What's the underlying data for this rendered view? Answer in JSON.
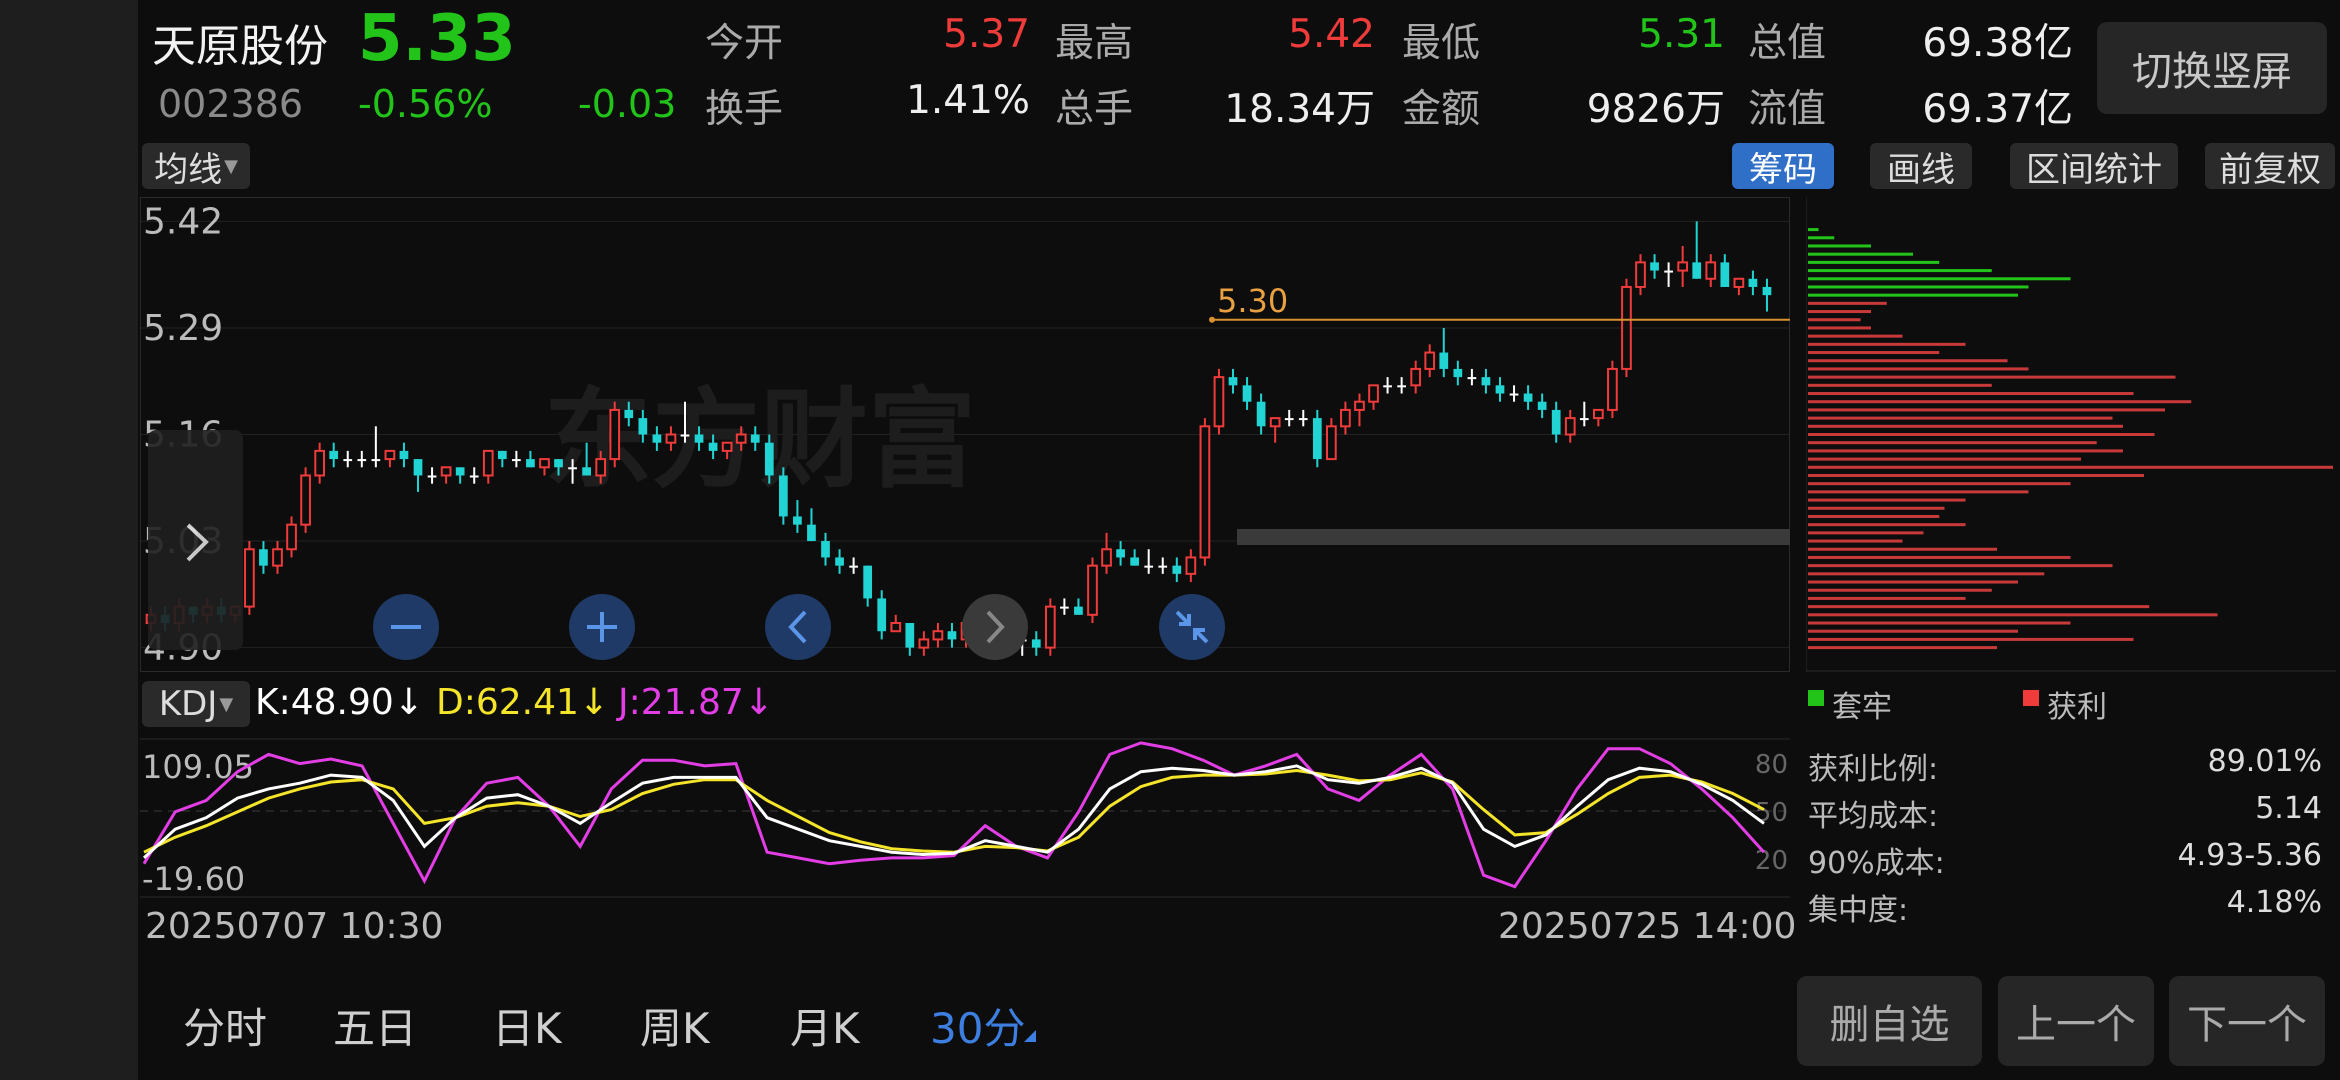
{
  "stock": {
    "name": "天原股份",
    "code": "002386",
    "price": "5.33",
    "change_pct": "-0.56%",
    "change": "-0.03"
  },
  "quote": {
    "open_label": "今开",
    "open": "5.37",
    "high_label": "最高",
    "high": "5.42",
    "low_label": "最低",
    "low": "5.31",
    "mcap_label": "总值",
    "mcap": "69.38亿",
    "turnover_label": "换手",
    "turnover": "1.41%",
    "volume_label": "总手",
    "volume": "18.34万",
    "amount_label": "金额",
    "amount": "9826万",
    "float_label": "流值",
    "float": "69.37亿"
  },
  "buttons": {
    "portrait": "切换竖屏",
    "ma": "均线",
    "chips": "筹码",
    "draw": "画线",
    "range_stats": "区间统计",
    "adjust": "前复权",
    "delete_fav": "删自选",
    "prev": "上一个",
    "next": "下一个"
  },
  "colors": {
    "up": "#f03b3b",
    "down": "#22d3d3",
    "k": "#ffffff",
    "d": "#f5e52a",
    "j": "#e33ee6",
    "accent": "#2f6fc8"
  },
  "price_axis": [
    "5.42",
    "5.29",
    "5.16",
    "5.03",
    "4.90"
  ],
  "marker_price": "5.30",
  "watermark": "东方财富",
  "kdj": {
    "selector": "KDJ",
    "k": "K:48.90↓",
    "d": "D:62.41↓",
    "j": "J:21.87↓",
    "axis_top": "109.05",
    "axis_bottom": "-19.60",
    "ref_levels": [
      "80",
      "50",
      "20"
    ]
  },
  "dates": {
    "start": "20250707 10:30",
    "end": "20250725 14:00"
  },
  "periods": [
    "分时",
    "五日",
    "日K",
    "周K",
    "月K",
    "30分"
  ],
  "active_period": "30分",
  "chips": {
    "legend_trapped": "套牢",
    "legend_profit": "获利",
    "profit_ratio_label": "获利比例:",
    "profit_ratio": "89.01%",
    "avg_cost_label": "平均成本:",
    "avg_cost": "5.14",
    "cost90_label": "90%成本:",
    "cost90": "4.93-5.36",
    "concentration_label": "集中度:",
    "concentration": "4.18%"
  },
  "chart_data": {
    "type": "candlestick",
    "ylim": [
      4.88,
      5.44
    ],
    "candles": [
      [
        4.93,
        4.95,
        4.92,
        4.94
      ],
      [
        4.94,
        4.95,
        4.92,
        4.93
      ],
      [
        4.93,
        4.96,
        4.92,
        4.95
      ],
      [
        4.95,
        4.95,
        4.93,
        4.94
      ],
      [
        4.94,
        4.96,
        4.93,
        4.95
      ],
      [
        4.95,
        4.96,
        4.93,
        4.94
      ],
      [
        4.94,
        4.95,
        4.93,
        4.95
      ],
      [
        4.95,
        5.03,
        4.94,
        5.02
      ],
      [
        5.02,
        5.03,
        4.99,
        5.0
      ],
      [
        5.0,
        5.03,
        4.99,
        5.02
      ],
      [
        5.02,
        5.06,
        5.01,
        5.05
      ],
      [
        5.05,
        5.12,
        5.04,
        5.11
      ],
      [
        5.11,
        5.15,
        5.1,
        5.14
      ],
      [
        5.14,
        5.15,
        5.12,
        5.13
      ],
      [
        5.13,
        5.14,
        5.12,
        5.13
      ],
      [
        5.13,
        5.14,
        5.12,
        5.13
      ],
      [
        5.13,
        5.17,
        5.12,
        5.13
      ],
      [
        5.13,
        5.14,
        5.12,
        5.14
      ],
      [
        5.14,
        5.15,
        5.12,
        5.13
      ],
      [
        5.13,
        5.13,
        5.09,
        5.11
      ],
      [
        5.11,
        5.12,
        5.1,
        5.11
      ],
      [
        5.11,
        5.12,
        5.1,
        5.12
      ],
      [
        5.12,
        5.12,
        5.1,
        5.11
      ],
      [
        5.11,
        5.12,
        5.1,
        5.11
      ],
      [
        5.11,
        5.14,
        5.1,
        5.14
      ],
      [
        5.14,
        5.14,
        5.12,
        5.13
      ],
      [
        5.13,
        5.14,
        5.12,
        5.13
      ],
      [
        5.13,
        5.14,
        5.12,
        5.12
      ],
      [
        5.12,
        5.13,
        5.11,
        5.13
      ],
      [
        5.13,
        5.13,
        5.11,
        5.12
      ],
      [
        5.12,
        5.13,
        5.1,
        5.12
      ],
      [
        5.12,
        5.15,
        5.11,
        5.11
      ],
      [
        5.11,
        5.14,
        5.1,
        5.13
      ],
      [
        5.13,
        5.2,
        5.12,
        5.19
      ],
      [
        5.19,
        5.2,
        5.17,
        5.18
      ],
      [
        5.18,
        5.19,
        5.15,
        5.16
      ],
      [
        5.16,
        5.17,
        5.14,
        5.15
      ],
      [
        5.15,
        5.17,
        5.14,
        5.16
      ],
      [
        5.16,
        5.2,
        5.15,
        5.16
      ],
      [
        5.16,
        5.17,
        5.14,
        5.15
      ],
      [
        5.15,
        5.16,
        5.13,
        5.14
      ],
      [
        5.14,
        5.15,
        5.13,
        5.15
      ],
      [
        5.15,
        5.17,
        5.14,
        5.16
      ],
      [
        5.16,
        5.17,
        5.14,
        5.15
      ],
      [
        5.15,
        5.16,
        5.1,
        5.11
      ],
      [
        5.11,
        5.12,
        5.05,
        5.06
      ],
      [
        5.06,
        5.08,
        5.04,
        5.05
      ],
      [
        5.05,
        5.07,
        5.03,
        5.03
      ],
      [
        5.03,
        5.04,
        5.0,
        5.01
      ],
      [
        5.01,
        5.02,
        4.99,
        5.0
      ],
      [
        5.0,
        5.01,
        4.99,
        5.0
      ],
      [
        5.0,
        5.0,
        4.95,
        4.96
      ],
      [
        4.96,
        4.97,
        4.91,
        4.92
      ],
      [
        4.92,
        4.94,
        4.92,
        4.93
      ],
      [
        4.93,
        4.93,
        4.89,
        4.9
      ],
      [
        4.9,
        4.92,
        4.89,
        4.91
      ],
      [
        4.91,
        4.93,
        4.9,
        4.92
      ],
      [
        4.92,
        4.93,
        4.9,
        4.91
      ],
      [
        4.91,
        4.94,
        4.9,
        4.93
      ],
      [
        4.93,
        4.95,
        4.92,
        4.93
      ],
      [
        4.93,
        4.94,
        4.91,
        4.92
      ],
      [
        4.92,
        4.93,
        4.9,
        4.91
      ],
      [
        4.91,
        4.92,
        4.89,
        4.91
      ],
      [
        4.91,
        4.92,
        4.89,
        4.9
      ],
      [
        4.9,
        4.96,
        4.89,
        4.95
      ],
      [
        4.95,
        4.96,
        4.94,
        4.95
      ],
      [
        4.95,
        4.96,
        4.94,
        4.94
      ],
      [
        4.94,
        5.01,
        4.93,
        5.0
      ],
      [
        5.0,
        5.04,
        4.99,
        5.02
      ],
      [
        5.02,
        5.03,
        5.0,
        5.01
      ],
      [
        5.01,
        5.02,
        5.0,
        5.0
      ],
      [
        5.0,
        5.02,
        4.99,
        5.0
      ],
      [
        5.0,
        5.01,
        4.99,
        5.0
      ],
      [
        5.0,
        5.01,
        4.98,
        4.99
      ],
      [
        4.99,
        5.02,
        4.98,
        5.01
      ],
      [
        5.01,
        5.18,
        5.0,
        5.17
      ],
      [
        5.17,
        5.24,
        5.16,
        5.23
      ],
      [
        5.23,
        5.24,
        5.21,
        5.22
      ],
      [
        5.22,
        5.23,
        5.19,
        5.2
      ],
      [
        5.2,
        5.21,
        5.16,
        5.17
      ],
      [
        5.17,
        5.18,
        5.15,
        5.18
      ],
      [
        5.18,
        5.19,
        5.17,
        5.18
      ],
      [
        5.18,
        5.19,
        5.17,
        5.18
      ],
      [
        5.18,
        5.19,
        5.12,
        5.13
      ],
      [
        5.13,
        5.18,
        5.13,
        5.17
      ],
      [
        5.17,
        5.2,
        5.16,
        5.19
      ],
      [
        5.19,
        5.21,
        5.17,
        5.2
      ],
      [
        5.2,
        5.22,
        5.19,
        5.22
      ],
      [
        5.22,
        5.23,
        5.21,
        5.22
      ],
      [
        5.22,
        5.23,
        5.21,
        5.22
      ],
      [
        5.22,
        5.25,
        5.21,
        5.24
      ],
      [
        5.24,
        5.27,
        5.23,
        5.26
      ],
      [
        5.26,
        5.29,
        5.23,
        5.24
      ],
      [
        5.24,
        5.25,
        5.22,
        5.23
      ],
      [
        5.23,
        5.24,
        5.22,
        5.23
      ],
      [
        5.23,
        5.24,
        5.21,
        5.22
      ],
      [
        5.22,
        5.23,
        5.2,
        5.21
      ],
      [
        5.21,
        5.22,
        5.2,
        5.21
      ],
      [
        5.21,
        5.22,
        5.19,
        5.2
      ],
      [
        5.2,
        5.21,
        5.18,
        5.19
      ],
      [
        5.19,
        5.2,
        5.15,
        5.16
      ],
      [
        5.16,
        5.19,
        5.15,
        5.18
      ],
      [
        5.18,
        5.2,
        5.17,
        5.18
      ],
      [
        5.18,
        5.19,
        5.17,
        5.19
      ],
      [
        5.19,
        5.25,
        5.18,
        5.24
      ],
      [
        5.24,
        5.35,
        5.23,
        5.34
      ],
      [
        5.34,
        5.38,
        5.33,
        5.37
      ],
      [
        5.37,
        5.38,
        5.35,
        5.36
      ],
      [
        5.36,
        5.37,
        5.34,
        5.36
      ],
      [
        5.36,
        5.39,
        5.34,
        5.37
      ],
      [
        5.37,
        5.42,
        5.35,
        5.35
      ],
      [
        5.35,
        5.38,
        5.34,
        5.37
      ],
      [
        5.37,
        5.38,
        5.34,
        5.34
      ],
      [
        5.34,
        5.35,
        5.33,
        5.35
      ],
      [
        5.35,
        5.36,
        5.33,
        5.34
      ],
      [
        5.34,
        5.35,
        5.31,
        5.33
      ]
    ],
    "kdj_series": {
      "K": [
        10,
        35,
        45,
        62,
        70,
        75,
        82,
        80,
        60,
        20,
        45,
        62,
        65,
        55,
        40,
        58,
        75,
        80,
        80,
        80,
        45,
        35,
        25,
        20,
        15,
        13,
        14,
        25,
        20,
        15,
        35,
        70,
        85,
        88,
        86,
        82,
        85,
        90,
        78,
        75,
        80,
        88,
        75,
        35,
        20,
        30,
        55,
        78,
        88,
        85,
        74,
        60,
        40
      ],
      "D": [
        15,
        28,
        38,
        50,
        62,
        70,
        76,
        78,
        70,
        40,
        45,
        55,
        58,
        55,
        46,
        52,
        66,
        74,
        78,
        78,
        60,
        46,
        32,
        24,
        18,
        16,
        15,
        20,
        19,
        16,
        28,
        55,
        72,
        80,
        82,
        82,
        83,
        86,
        82,
        77,
        78,
        84,
        76,
        52,
        30,
        32,
        48,
        66,
        80,
        82,
        76,
        66,
        52
      ],
      "J": [
        5,
        50,
        60,
        85,
        100,
        92,
        96,
        90,
        40,
        -10,
        45,
        75,
        80,
        55,
        20,
        70,
        95,
        95,
        90,
        92,
        15,
        10,
        5,
        8,
        10,
        10,
        12,
        38,
        20,
        10,
        50,
        100,
        110,
        105,
        95,
        82,
        90,
        100,
        70,
        60,
        82,
        100,
        70,
        -5,
        -15,
        25,
        70,
        105,
        105,
        92,
        70,
        45,
        15
      ]
    },
    "chip_distribution": [
      {
        "price": 5.41,
        "value": 0.02,
        "side": "trapped"
      },
      {
        "price": 5.4,
        "value": 0.05,
        "side": "trapped"
      },
      {
        "price": 5.39,
        "value": 0.12,
        "side": "trapped"
      },
      {
        "price": 5.38,
        "value": 0.2,
        "side": "trapped"
      },
      {
        "price": 5.37,
        "value": 0.25,
        "side": "trapped"
      },
      {
        "price": 5.36,
        "value": 0.35,
        "side": "trapped"
      },
      {
        "price": 5.35,
        "value": 0.5,
        "side": "trapped"
      },
      {
        "price": 5.34,
        "value": 0.42,
        "side": "trapped"
      },
      {
        "price": 5.33,
        "value": 0.4,
        "side": "trapped"
      },
      {
        "price": 5.32,
        "value": 0.15,
        "side": "profit"
      },
      {
        "price": 5.31,
        "value": 0.12,
        "side": "profit"
      },
      {
        "price": 5.3,
        "value": 0.1,
        "side": "profit"
      },
      {
        "price": 5.29,
        "value": 0.12,
        "side": "profit"
      },
      {
        "price": 5.28,
        "value": 0.18,
        "side": "profit"
      },
      {
        "price": 5.27,
        "value": 0.3,
        "side": "profit"
      },
      {
        "price": 5.26,
        "value": 0.25,
        "side": "profit"
      },
      {
        "price": 5.25,
        "value": 0.38,
        "side": "profit"
      },
      {
        "price": 5.24,
        "value": 0.42,
        "side": "profit"
      },
      {
        "price": 5.23,
        "value": 0.7,
        "side": "profit"
      },
      {
        "price": 5.22,
        "value": 0.35,
        "side": "profit"
      },
      {
        "price": 5.21,
        "value": 0.62,
        "side": "profit"
      },
      {
        "price": 5.2,
        "value": 0.73,
        "side": "profit"
      },
      {
        "price": 5.19,
        "value": 0.68,
        "side": "profit"
      },
      {
        "price": 5.18,
        "value": 0.58,
        "side": "profit"
      },
      {
        "price": 5.17,
        "value": 0.6,
        "side": "profit"
      },
      {
        "price": 5.16,
        "value": 0.66,
        "side": "profit"
      },
      {
        "price": 5.15,
        "value": 0.55,
        "side": "profit"
      },
      {
        "price": 5.14,
        "value": 0.6,
        "side": "profit"
      },
      {
        "price": 5.13,
        "value": 0.52,
        "side": "profit"
      },
      {
        "price": 5.12,
        "value": 1.0,
        "side": "profit"
      },
      {
        "price": 5.11,
        "value": 0.64,
        "side": "profit"
      },
      {
        "price": 5.1,
        "value": 0.5,
        "side": "profit"
      },
      {
        "price": 5.09,
        "value": 0.42,
        "side": "profit"
      },
      {
        "price": 5.08,
        "value": 0.3,
        "side": "profit"
      },
      {
        "price": 5.07,
        "value": 0.26,
        "side": "profit"
      },
      {
        "price": 5.06,
        "value": 0.25,
        "side": "profit"
      },
      {
        "price": 5.05,
        "value": 0.3,
        "side": "profit"
      },
      {
        "price": 5.04,
        "value": 0.22,
        "side": "profit"
      },
      {
        "price": 5.03,
        "value": 0.18,
        "side": "profit"
      },
      {
        "price": 5.02,
        "value": 0.36,
        "side": "profit"
      },
      {
        "price": 5.01,
        "value": 0.5,
        "side": "profit"
      },
      {
        "price": 5.0,
        "value": 0.58,
        "side": "profit"
      },
      {
        "price": 4.99,
        "value": 0.45,
        "side": "profit"
      },
      {
        "price": 4.98,
        "value": 0.4,
        "side": "profit"
      },
      {
        "price": 4.97,
        "value": 0.35,
        "side": "profit"
      },
      {
        "price": 4.96,
        "value": 0.3,
        "side": "profit"
      },
      {
        "price": 4.95,
        "value": 0.65,
        "side": "profit"
      },
      {
        "price": 4.94,
        "value": 0.78,
        "side": "profit"
      },
      {
        "price": 4.93,
        "value": 0.5,
        "side": "profit"
      },
      {
        "price": 4.92,
        "value": 0.4,
        "side": "profit"
      },
      {
        "price": 4.91,
        "value": 0.62,
        "side": "profit"
      },
      {
        "price": 4.9,
        "value": 0.36,
        "side": "profit"
      }
    ]
  }
}
